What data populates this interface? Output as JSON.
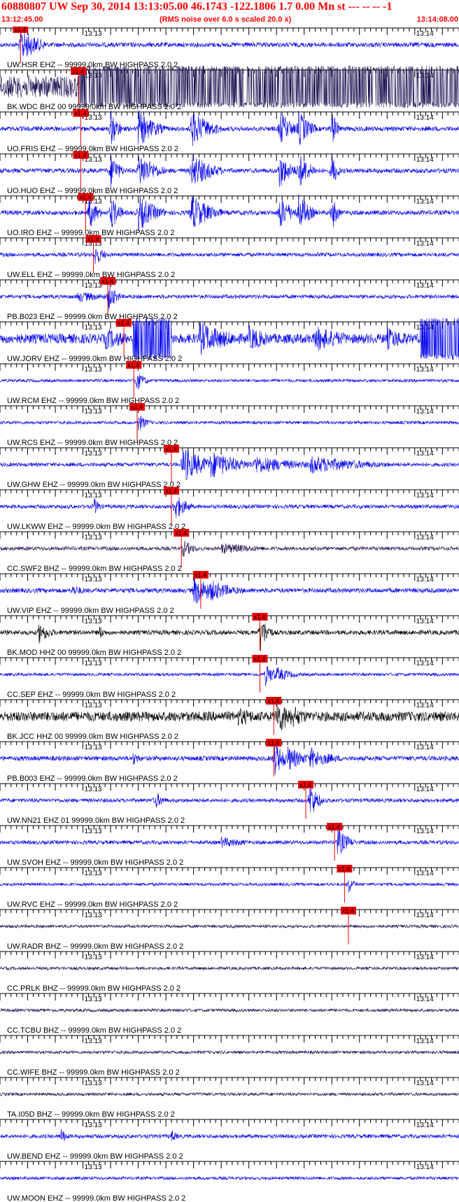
{
  "header": {
    "title": "60880807 UW Sep 30, 2014 13:13:05.00   46.1743 -122.1806  1.7 0.00 Mn st --- -- --   -1",
    "start_time": "13:12:45.00",
    "noise_note": "(RMS noise over 6.0 s scaled 20.0 x)",
    "end_time": "13:14:08.00"
  },
  "colors": {
    "header_red": "#ff0000",
    "blue": "#0000ee",
    "navy": "#1a1050",
    "purple": "#2a1550",
    "black": "#000000",
    "pick_red": "#ee0000"
  },
  "chart_data": {
    "type": "seismogram",
    "time_range": [
      "13:12:45.00",
      "13:14:08.00"
    ],
    "time_span_s": 83,
    "minute_labels": [
      {
        "label": "13:13",
        "t": 15
      },
      {
        "label": "13:14",
        "t": 75
      }
    ],
    "pick_label": "x1.4",
    "traces": [
      {
        "name": "UW.HSR EHZ -- 99999.0km BW  HIGHPASS  2.0  2",
        "color": "blue",
        "amp": 0.12,
        "pick_t": 3.7,
        "events": [
          [
            3.7,
            3,
            1.0
          ]
        ]
      },
      {
        "name": "BK.WDC BHZ 00 99999.0km BW  HIGHPASS  2.0  2",
        "color": "navy",
        "amp": 0.55,
        "pick_t": 14.2,
        "saturated": [
          [
            14.2,
            83
          ]
        ],
        "events": []
      },
      {
        "name": "UO.FRIS EHZ -- 99999.0km BW  HIGHPASS  2.0  2",
        "color": "blue",
        "amp": 0.12,
        "pick_t": 14.6,
        "events": [
          [
            20,
            1.5,
            1
          ],
          [
            25,
            3,
            1
          ],
          [
            34.5,
            3.5,
            1
          ],
          [
            50.5,
            2,
            1
          ],
          [
            54,
            2,
            1
          ],
          [
            60,
            1,
            1
          ]
        ]
      },
      {
        "name": "UO.HUO EHZ -- 99999.0km BW  HIGHPASS  2.0  2",
        "color": "blue",
        "amp": 0.12,
        "pick_t": 14.6,
        "events": [
          [
            20,
            1.5,
            1
          ],
          [
            25,
            3,
            1
          ],
          [
            34.5,
            3.5,
            1
          ],
          [
            50.5,
            2,
            1
          ],
          [
            54,
            2,
            1
          ],
          [
            60,
            1,
            1
          ]
        ]
      },
      {
        "name": "UO.IRO EHZ -- 99999.0km BW  HIGHPASS  2.0  2",
        "color": "blue",
        "amp": 0.12,
        "pick_t": 15.5,
        "events": [
          [
            16,
            1.5,
            1
          ],
          [
            20,
            1.5,
            1
          ],
          [
            25,
            3,
            1
          ],
          [
            34.5,
            3.5,
            1
          ],
          [
            50.5,
            2,
            1
          ],
          [
            54,
            2,
            1
          ],
          [
            60,
            1,
            1
          ]
        ]
      },
      {
        "name": "UW.ELL EHZ -- 99999.0km BW  HIGHPASS  2.0  2",
        "color": "blue",
        "amp": 0.1,
        "pick_t": 16.9,
        "events": [
          [
            17.2,
            1.5,
            0.6
          ]
        ]
      },
      {
        "name": "PB.B023 EHZ -- 99999.0km BW  HIGHPASS  2.0  2",
        "color": "blue",
        "amp": 0.1,
        "pick_t": 19.5,
        "events": [
          [
            19.5,
            1.5,
            0.8
          ],
          [
            14,
            6,
            0.3
          ]
        ]
      },
      {
        "name": "UW.JORV EHZ -- 99999.0km BW  HIGHPASS  2.0  2",
        "color": "blue",
        "amp": 0.25,
        "pick_t": 22.4,
        "saturated": [
          [
            24,
            31
          ],
          [
            76,
            83
          ]
        ],
        "events": [
          [
            19,
            5,
            0.6
          ],
          [
            36,
            6,
            0.9
          ],
          [
            45,
            4,
            0.7
          ],
          [
            57,
            6,
            0.7
          ],
          [
            70,
            5,
            0.6
          ]
        ]
      },
      {
        "name": "UW.RCM EHZ -- 99999.0km BW  HIGHPASS  2.0  2",
        "color": "blue",
        "amp": 0.08,
        "pick_t": 24.2,
        "events": [
          [
            24.5,
            1.5,
            0.6
          ]
        ]
      },
      {
        "name": "UW.RCS EHZ -- 99999.0km BW  HIGHPASS  2.0  2",
        "color": "blue",
        "amp": 0.08,
        "pick_t": 24.8,
        "events": [
          [
            25,
            1.5,
            0.5
          ]
        ]
      },
      {
        "name": "UW.GHW EHZ -- 99999.0km BW  HIGHPASS  2.0  2",
        "color": "blue",
        "amp": 0.1,
        "pick_t": 31.0,
        "events": [
          [
            33,
            4,
            1
          ],
          [
            38,
            5,
            0.8
          ],
          [
            46,
            8,
            0.5
          ],
          [
            56,
            10,
            0.5
          ]
        ]
      },
      {
        "name": "UW.LKWW EHZ -- 99999.0km BW  HIGHPASS  2.0  2",
        "color": "blue",
        "amp": 0.1,
        "pick_t": 31.0,
        "events": [
          [
            17,
            1,
            0.5
          ],
          [
            31.5,
            2,
            0.8
          ]
        ]
      },
      {
        "name": "CC.SWF2 BHZ -- 99999.0km BW  HIGHPASS  2.0  2",
        "color": "purple",
        "amp": 0.1,
        "pick_t": 32.8,
        "events": [
          [
            33,
            2,
            0.5
          ],
          [
            40,
            8,
            0.3
          ]
        ]
      },
      {
        "name": "UW.VIP EHZ -- 99999.0km BW  HIGHPASS  2.0  2",
        "color": "blue",
        "amp": 0.12,
        "pick_t": 36.3,
        "events": [
          [
            35,
            4,
            0.8
          ],
          [
            38,
            4,
            0.6
          ],
          [
            13,
            3,
            0.3
          ]
        ]
      },
      {
        "name": "BK.MOD HHZ 00 99999.0km BW  HIGHPASS  2.0  2",
        "color": "black",
        "amp": 0.12,
        "pick_t": 47.0,
        "events": [
          [
            7,
            2,
            0.6
          ],
          [
            18,
            1,
            0.4
          ],
          [
            47,
            1.5,
            1
          ]
        ]
      },
      {
        "name": "CC.SEP EHZ -- 99999.0km BW  HIGHPASS  2.0  2",
        "color": "blue",
        "amp": 0.08,
        "pick_t": 47.0,
        "events": [
          [
            48,
            2,
            0.6
          ],
          [
            50,
            3,
            0.4
          ]
        ]
      },
      {
        "name": "BK.JCC HHZ 00 99999.0km BW  HIGHPASS  2.0  2",
        "color": "black",
        "amp": 0.25,
        "pick_t": 49.5,
        "events": [
          [
            43,
            5,
            0.5
          ],
          [
            50,
            3,
            1.0
          ],
          [
            53,
            3,
            0.6
          ]
        ]
      },
      {
        "name": "PB.B003 EHZ -- 99999.0km BW  HIGHPASS  2.0  2",
        "color": "blue",
        "amp": 0.12,
        "pick_t": 49.5,
        "events": [
          [
            49.5,
            2,
            1.0
          ],
          [
            52,
            3,
            0.7
          ],
          [
            56,
            4,
            0.6
          ],
          [
            24,
            1.5,
            0.4
          ]
        ]
      },
      {
        "name": "UW.NN21 EHZ 01 99999.0km BW  HIGHPASS  2.0  2",
        "color": "blue",
        "amp": 0.1,
        "pick_t": 55.3,
        "events": [
          [
            56,
            1.5,
            1
          ],
          [
            28,
            1.5,
            0.5
          ]
        ]
      },
      {
        "name": "UW.SVOH EHZ -- 99999.0km BW  HIGHPASS  2.0  2",
        "color": "blue",
        "amp": 0.1,
        "pick_t": 60.5,
        "events": [
          [
            61,
            2,
            0.8
          ],
          [
            40,
            5,
            0.3
          ]
        ]
      },
      {
        "name": "UW.RVC EHZ -- 99999.0km BW  HIGHPASS  2.0  2",
        "color": "blue",
        "amp": 0.08,
        "pick_t": 62.3,
        "events": [
          [
            63,
            1,
            0.5
          ]
        ]
      },
      {
        "name": "UW.RADR BHZ -- 99999.0km BW  HIGHPASS  2.0  2",
        "color": "navy",
        "amp": 0.08,
        "pick_t": 63.0,
        "events": []
      },
      {
        "name": "CC.PRLK BHZ -- 99999.0km BW  HIGHPASS  2.0  2",
        "color": "navy",
        "amp": 0.08,
        "events": []
      },
      {
        "name": "CC.TCBU BHZ -- 99999.0km BW  HIGHPASS  2.0  2",
        "color": "navy",
        "amp": 0.08,
        "events": []
      },
      {
        "name": "CC.WIFE BHZ -- 99999.0km BW  HIGHPASS  2.0  2",
        "color": "navy",
        "amp": 0.08,
        "events": []
      },
      {
        "name": "TA.I05D BHZ -- 99999.0km BW  HIGHPASS  2.0  2",
        "color": "navy",
        "amp": 0.08,
        "events": []
      },
      {
        "name": "UW.BEND EHZ -- 99999.0km BW  HIGHPASS  2.0  2",
        "color": "blue",
        "amp": 0.1,
        "events": [
          [
            11,
            1,
            0.5
          ],
          [
            31,
            1,
            0.4
          ]
        ]
      },
      {
        "name": "UW.MOON EHZ -- 99999.0km BW  HIGHPASS  2.0  2",
        "color": "blue",
        "amp": 0.08,
        "events": []
      }
    ]
  }
}
